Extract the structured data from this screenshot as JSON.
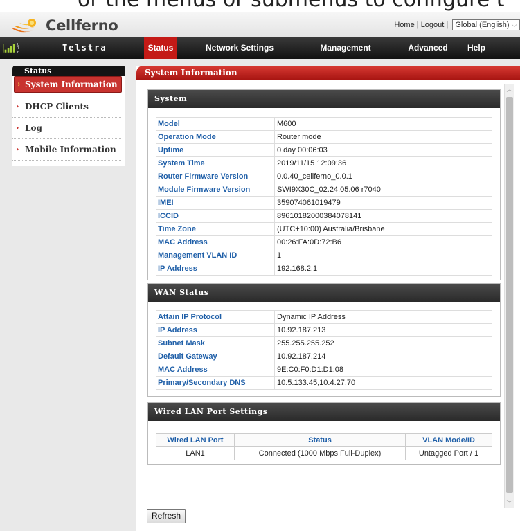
{
  "caption": "or the menus or submenus to configure t",
  "header": {
    "logo_text": "Cellferno",
    "links": [
      "Home",
      "Logout"
    ],
    "language": "Global (English)"
  },
  "navbar": {
    "brand": "Telstra",
    "lte": [
      "L",
      "T",
      "E"
    ],
    "items": [
      "Status",
      "Network Settings",
      "Management",
      "Advanced",
      "Help"
    ],
    "active": "Status"
  },
  "sidebar": {
    "title": "Status",
    "items": [
      "System Information",
      "DHCP Clients",
      "Log",
      "Mobile Information"
    ],
    "active_index": 0
  },
  "content": {
    "title": "System Information",
    "system": {
      "heading": "System",
      "rows": [
        {
          "label": "Model",
          "value": "M600"
        },
        {
          "label": "Operation Mode",
          "value": "Router mode"
        },
        {
          "label": "Uptime",
          "value": "0 day 00:06:03"
        },
        {
          "label": "System Time",
          "value": "2019/11/15 12:09:36"
        },
        {
          "label": "Router Firmware Version",
          "value": "0.0.40_cellferno_0.0.1"
        },
        {
          "label": "Module Firmware Version",
          "value": "SWI9X30C_02.24.05.06 r7040"
        },
        {
          "label": "IMEI",
          "value": "359074061019479"
        },
        {
          "label": "ICCID",
          "value": "89610182000384078141"
        },
        {
          "label": "Time Zone",
          "value": "(UTC+10:00) Australia/Brisbane"
        },
        {
          "label": "MAC Address",
          "value": "00:26:FA:0D:72:B6"
        },
        {
          "label": "Management VLAN ID",
          "value": "1"
        },
        {
          "label": "IP Address",
          "value": "192.168.2.1"
        }
      ]
    },
    "wan": {
      "heading": "WAN Status",
      "rows": [
        {
          "label": "Attain IP Protocol",
          "value": "Dynamic IP Address"
        },
        {
          "label": "IP Address",
          "value": "10.92.187.213"
        },
        {
          "label": "Subnet Mask",
          "value": "255.255.255.252"
        },
        {
          "label": "Default Gateway",
          "value": "10.92.187.214"
        },
        {
          "label": "MAC Address",
          "value": "9E:C0:F0:D1:D1:08"
        },
        {
          "label": "Primary/Secondary DNS",
          "value": "10.5.133.45,10.4.27.70"
        }
      ]
    },
    "lan": {
      "heading": "Wired LAN Port Settings",
      "columns": [
        "Wired LAN Port",
        "Status",
        "VLAN Mode/ID"
      ],
      "rows": [
        [
          "LAN1",
          "Connected (1000 Mbps Full-Duplex)",
          "Untagged Port  /  1"
        ]
      ]
    },
    "refresh_label": "Refresh"
  },
  "colors": {
    "accent_red": "#c41a16",
    "link_blue": "#1f5fa8",
    "nav_dark": "#1a1a1a"
  }
}
